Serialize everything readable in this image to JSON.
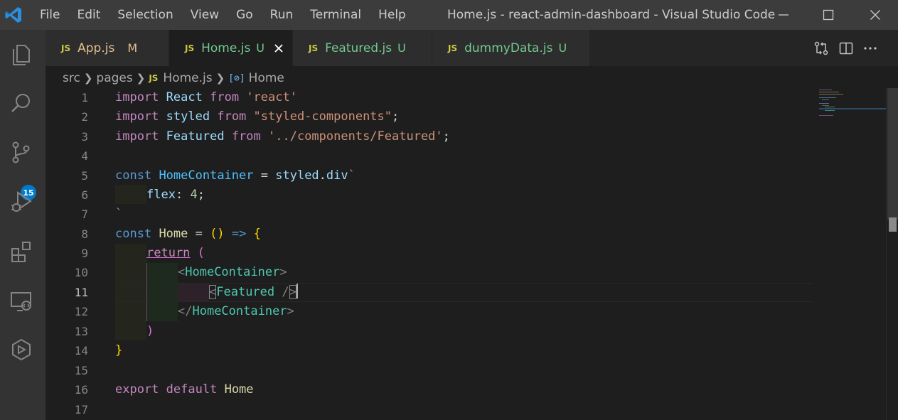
{
  "titlebar": {
    "menu": [
      "File",
      "Edit",
      "Selection",
      "View",
      "Go",
      "Run",
      "Terminal",
      "Help"
    ],
    "window_title": "Home.js - react-admin-dashboard - Visual Studio Code"
  },
  "activity": {
    "source_control_badge": "15"
  },
  "tabs": [
    {
      "icon_label": "JS",
      "name": "App.js",
      "status": "M"
    },
    {
      "icon_label": "JS",
      "name": "Home.js",
      "status": "U"
    },
    {
      "icon_label": "JS",
      "name": "Featured.js",
      "status": "U"
    },
    {
      "icon_label": "JS",
      "name": "dummyData.js",
      "status": "U"
    }
  ],
  "breadcrumb": {
    "folder1": "src",
    "folder2": "pages",
    "file_icon": "JS",
    "file": "Home.js",
    "symbol_icon": "[⊘]",
    "symbol": "Home"
  },
  "editor": {
    "line_numbers": [
      "1",
      "2",
      "3",
      "4",
      "5",
      "6",
      "7",
      "8",
      "9",
      "10",
      "11",
      "12",
      "13",
      "14",
      "15",
      "16",
      "17"
    ],
    "current_line": "11",
    "lines": {
      "l1": {
        "a": "import",
        "b": "React",
        "c": "from",
        "d": "'react'"
      },
      "l2": {
        "a": "import",
        "b": "styled",
        "c": "from",
        "d": "\"styled-components\"",
        "e": ";"
      },
      "l3": {
        "a": "import",
        "b": "Featured",
        "c": "from",
        "d": "'../components/Featured'",
        "e": ";"
      },
      "l5": {
        "a": "const",
        "b": "HomeContainer",
        "c": "=",
        "d": "styled",
        "e": ".",
        "f": "div",
        "g": "`"
      },
      "l6": {
        "a": "flex",
        "b": ": ",
        "c": "4",
        "d": ";"
      },
      "l7": {
        "a": "`"
      },
      "l8": {
        "a": "const",
        "b": "Home",
        "c": "=",
        "d": "()",
        "e": "=>",
        "f": "{"
      },
      "l9": {
        "a": "return",
        "b": "("
      },
      "l10": {
        "a": "<",
        "b": "HomeContainer",
        "c": ">"
      },
      "l11": {
        "a": "<",
        "b": "Featured",
        "c": "/",
        "d": ">"
      },
      "l12": {
        "a": "</",
        "b": "HomeContainer",
        "c": ">"
      },
      "l13": {
        "a": ")"
      },
      "l14": {
        "a": "}"
      },
      "l16": {
        "a": "export",
        "b": "default",
        "c": "Home"
      }
    }
  },
  "colors": {
    "titlebar": "#3c3c3c",
    "activitybar": "#333333",
    "editor": "#1e1e1e",
    "accent": "#007acc",
    "untracked": "#73c991",
    "modified": "#e2c08d"
  }
}
